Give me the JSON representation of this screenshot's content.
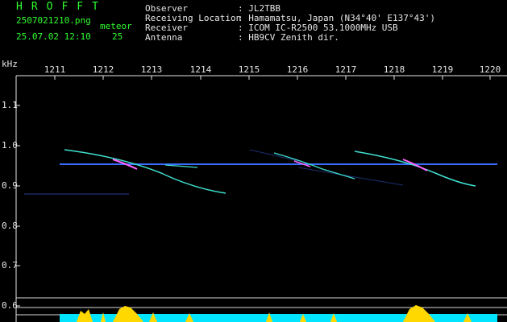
{
  "header": {
    "brand": "HROFFT",
    "filename": "2507021210.png",
    "timestamp": "25.07.02 12:10",
    "meteor_label": "meteor",
    "meteor_count": "25",
    "observer_label": "Observer",
    "observer_value": ": JL2TBB",
    "location_label": "Receiving Location",
    "location_value": ": Hamamatsu, Japan (N34°40' E137°43')",
    "receiver_label": "Receiver",
    "receiver_value": ": ICOM IC-R2500 53.1000MHz USB",
    "antenna_label": "Antenna",
    "antenna_value": ": HB9CV Zenith dir."
  },
  "axes": {
    "y_unit": "kHz",
    "x_ticks": [
      "1211",
      "1212",
      "1213",
      "1214",
      "1215",
      "1216",
      "1217",
      "1218",
      "1219",
      "1220"
    ],
    "y_ticks": [
      "1.1",
      "1.0",
      "0.9",
      "0.8",
      "0.7",
      "0.6"
    ]
  },
  "colors": {
    "background": "#000000",
    "text_white": "#e6e6e6",
    "text_green": "#2fff2f",
    "carrier": "#3a6dff",
    "echo": "#40e0d0",
    "echo_hot": "#ff66ff",
    "bottom_bar": "#00e5ff",
    "bottom_peak": "#ffd800"
  }
}
